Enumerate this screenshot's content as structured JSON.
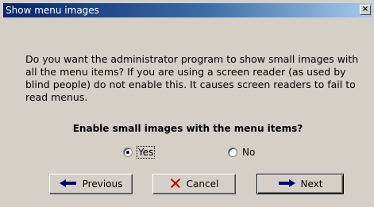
{
  "window": {
    "title": "Show menu images",
    "close_glyph": "×"
  },
  "message": "Do you want the administrator program to show small images with all the menu items? If you are using a screen reader (as used by blind people) do not enable this. It causes screen readers to fail to read menus.",
  "question": "Enable small images with the menu items?",
  "options": {
    "yes_label": "Yes",
    "no_label": "No",
    "selected": "Yes"
  },
  "buttons": {
    "previous_label": "Previous",
    "cancel_label": "Cancel",
    "next_label": "Next"
  },
  "colors": {
    "titlebar_start": "#0a246a",
    "titlebar_end": "#a6caf0",
    "arrow_blue": "#000080",
    "cancel_red": "#cc0000"
  }
}
